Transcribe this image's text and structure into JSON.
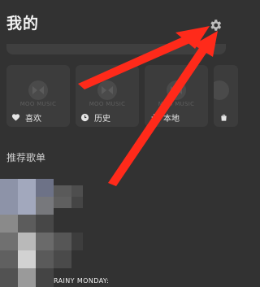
{
  "header": {
    "title": "我的",
    "settings_icon": "gear-icon"
  },
  "quick_cards": [
    {
      "label": "喜欢",
      "icon": "heart-icon",
      "brand": "MOO MUSIC"
    },
    {
      "label": "历史",
      "icon": "clock-icon",
      "brand": "MOO MUSIC"
    },
    {
      "label": "本地",
      "icon": "download-icon",
      "brand": "MOO MUSIC"
    },
    {
      "label": "",
      "icon": "bag-icon",
      "brand": "MOO MUSIC"
    }
  ],
  "recommended": {
    "section_title": "推荐歌单",
    "playlist_caption": "RAINY MONDAY:"
  },
  "colors": {
    "background": "#323232",
    "card": "#3c3c3c",
    "annotation_arrow": "#ff2a1a"
  }
}
